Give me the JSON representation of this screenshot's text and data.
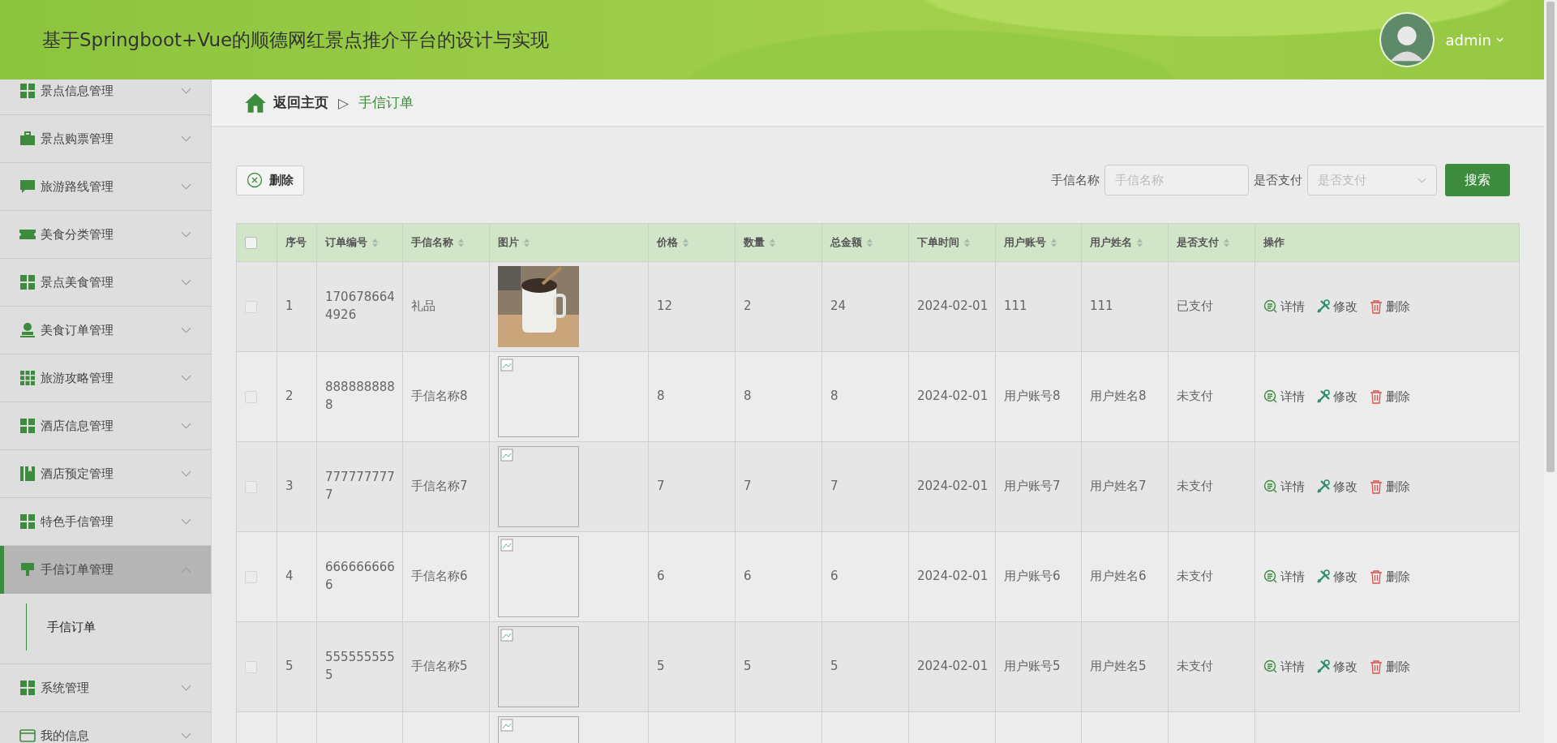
{
  "header": {
    "title": "基于Springboot+Vue的顺德网红景点推介平台的设计与实现",
    "user": "admin"
  },
  "sidebar": {
    "items": [
      {
        "label": "景点信息管理",
        "expanded": false,
        "selected": false
      },
      {
        "label": "景点购票管理",
        "expanded": false,
        "selected": false
      },
      {
        "label": "旅游路线管理",
        "expanded": false,
        "selected": false
      },
      {
        "label": "美食分类管理",
        "expanded": false,
        "selected": false
      },
      {
        "label": "景点美食管理",
        "expanded": false,
        "selected": false
      },
      {
        "label": "美食订单管理",
        "expanded": false,
        "selected": false
      },
      {
        "label": "旅游攻略管理",
        "expanded": false,
        "selected": false
      },
      {
        "label": "酒店信息管理",
        "expanded": false,
        "selected": false
      },
      {
        "label": "酒店预定管理",
        "expanded": false,
        "selected": false
      },
      {
        "label": "特色手信管理",
        "expanded": false,
        "selected": false
      },
      {
        "label": "手信订单管理",
        "expanded": true,
        "selected": true,
        "children": [
          {
            "label": "手信订单",
            "selected": true
          }
        ]
      },
      {
        "label": "系统管理",
        "expanded": false,
        "selected": false
      },
      {
        "label": "我的信息",
        "expanded": false,
        "selected": false
      }
    ]
  },
  "breadcrumb": {
    "home": "返回主页",
    "separator": "▷",
    "current": "手信订单"
  },
  "toolbar": {
    "delete_button": "删除",
    "filters": [
      {
        "label": "手信名称",
        "kind": "text",
        "placeholder": "手信名称"
      },
      {
        "label": "是否支付",
        "kind": "select",
        "placeholder": "是否支付"
      }
    ],
    "search_button": "搜索"
  },
  "table": {
    "select_all_checked": false,
    "columns": [
      {
        "label": "序号",
        "sortable": false
      },
      {
        "label": "订单编号",
        "sortable": true
      },
      {
        "label": "手信名称",
        "sortable": true
      },
      {
        "label": "图片",
        "sortable": true
      },
      {
        "label": "价格",
        "sortable": true
      },
      {
        "label": "数量",
        "sortable": true
      },
      {
        "label": "总金额",
        "sortable": true
      },
      {
        "label": "下单时间",
        "sortable": true
      },
      {
        "label": "用户账号",
        "sortable": true
      },
      {
        "label": "用户姓名",
        "sortable": true
      },
      {
        "label": "是否支付",
        "sortable": true
      },
      {
        "label": "操作",
        "sortable": false
      }
    ],
    "rows": [
      {
        "checked": false,
        "cells": [
          "1",
          "1706786644926",
          "礼品",
          {
            "kind": "picture"
          },
          "12",
          "2",
          "24",
          "2024-02-01",
          "111",
          "111",
          "已支付"
        ],
        "actions": [
          "详情",
          "修改",
          "删除"
        ]
      },
      {
        "checked": false,
        "cells": [
          "2",
          "8888888888",
          "手信名称8",
          {
            "kind": "broken"
          },
          "8",
          "8",
          "8",
          "2024-02-01",
          "用户账号8",
          "用户姓名8",
          "未支付"
        ],
        "actions": [
          "详情",
          "修改",
          "删除"
        ]
      },
      {
        "checked": false,
        "cells": [
          "3",
          "7777777777",
          "手信名称7",
          {
            "kind": "broken"
          },
          "7",
          "7",
          "7",
          "2024-02-01",
          "用户账号7",
          "用户姓名7",
          "未支付"
        ],
        "actions": [
          "详情",
          "修改",
          "删除"
        ]
      },
      {
        "checked": false,
        "cells": [
          "4",
          "6666666666",
          "手信名称6",
          {
            "kind": "broken"
          },
          "6",
          "6",
          "6",
          "2024-02-01",
          "用户账号6",
          "用户姓名6",
          "未支付"
        ],
        "actions": [
          "详情",
          "修改",
          "删除"
        ]
      },
      {
        "checked": false,
        "cells": [
          "5",
          "5555555555",
          "手信名称5",
          {
            "kind": "broken"
          },
          "5",
          "5",
          "5",
          "2024-02-01",
          "用户账号5",
          "用户姓名5",
          "未支付"
        ],
        "actions": [
          "详情",
          "修改",
          "删除"
        ]
      },
      {
        "cells": [
          "",
          "",
          "",
          {
            "kind": "broken"
          }
        ],
        "actions": []
      }
    ]
  }
}
